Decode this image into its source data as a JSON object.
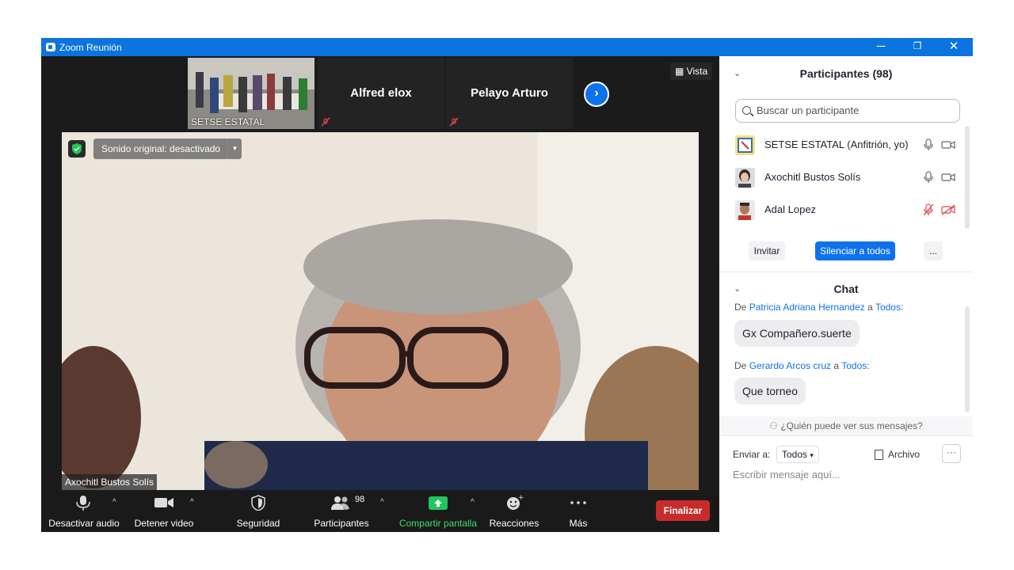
{
  "window": {
    "title": "Zoom Reunión",
    "controls": [
      "─",
      "❐",
      "✕"
    ]
  },
  "gallery": {
    "tiles": [
      {
        "name": "SETSE ESTATAL",
        "type": "video"
      },
      {
        "name": "Alfred elox",
        "type": "name"
      },
      {
        "name": "Pelayo Arturo",
        "type": "name"
      }
    ],
    "view_label": "Vista"
  },
  "main_video": {
    "sound_label": "Sonido original: desactivado",
    "speaker_name": "Axochitl Bustos Solís"
  },
  "toolbar": {
    "mute": "Desactivar audio",
    "video": "Detener video",
    "security": "Seguridad",
    "participants": "Participantes",
    "participants_count": "98",
    "share": "Compartir pantalla",
    "reactions": "Reacciones",
    "more": "Más",
    "end": "Finalizar"
  },
  "participants_panel": {
    "title": "Participantes (98)",
    "search_placeholder": "Buscar un participante",
    "list": [
      {
        "name": "SETSE ESTATAL (Anfitrión, yo)",
        "muted": false
      },
      {
        "name": "Axochitl Bustos Solís",
        "muted": false
      },
      {
        "name": "Adal Lopez",
        "muted": true
      }
    ],
    "invite": "Invitar",
    "mute_all": "Silenciar a todos",
    "more": "..."
  },
  "chat_panel": {
    "title": "Chat",
    "messages": [
      {
        "prefix": "De",
        "from": "Patricia Adriana Hernandez",
        "to_word": "a",
        "to": "Todos:",
        "text": "Gx Compañero.suerte"
      },
      {
        "prefix": "De",
        "from": "Gerardo Arcos cruz",
        "to_word": "a",
        "to": "Todos:",
        "text": "Que torneo"
      }
    ],
    "who_can_see": "¿Quién puede ver sus mensajes?",
    "send_to_label": "Enviar a:",
    "send_to_value": "Todos",
    "file_label": "Archivo",
    "more": "···",
    "input_placeholder": "Escribir mensaje aquí..."
  },
  "colors": {
    "accent": "#0e72ed",
    "titlebar": "#0b74de",
    "end_button": "#c82b2b",
    "share_green": "#22c55e",
    "muted_red": "#e0474c"
  }
}
